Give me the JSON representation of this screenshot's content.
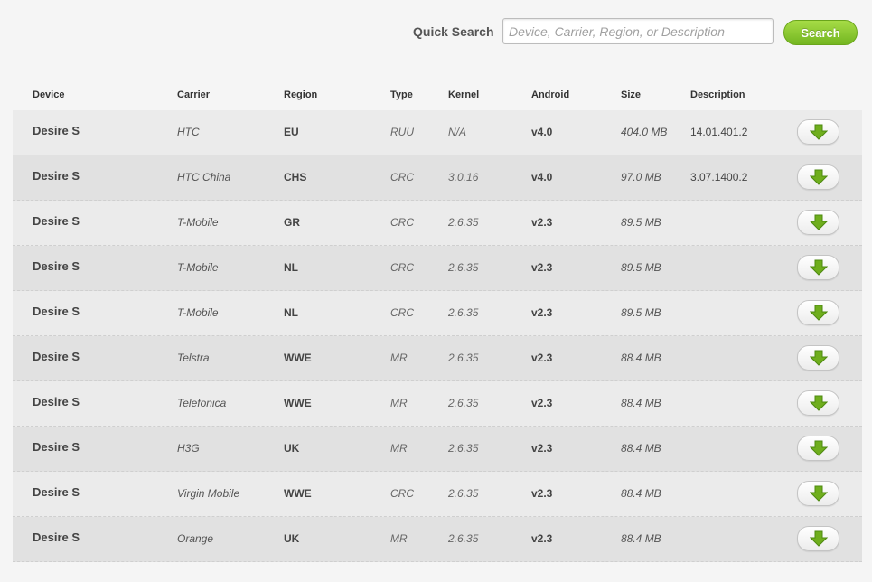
{
  "search": {
    "label": "Quick Search",
    "placeholder": "Device, Carrier, Region, or Description",
    "value": "",
    "button_label": "Search"
  },
  "table": {
    "headers": {
      "device": "Device",
      "carrier": "Carrier",
      "region": "Region",
      "type": "Type",
      "kernel": "Kernel",
      "android": "Android",
      "size": "Size",
      "description": "Description"
    },
    "rows": [
      {
        "device": "Desire S",
        "carrier": "HTC",
        "region": "EU",
        "type": "RUU",
        "kernel": "N/A",
        "android": "v4.0",
        "size": "404.0 MB",
        "description": "14.01.401.2",
        "action_icon": "download-arrow-icon"
      },
      {
        "device": "Desire S",
        "carrier": "HTC China",
        "region": "CHS",
        "type": "CRC",
        "kernel": "3.0.16",
        "android": "v4.0",
        "size": "97.0 MB",
        "description": "3.07.1400.2",
        "action_icon": "download-arrow-icon"
      },
      {
        "device": "Desire S",
        "carrier": "T-Mobile",
        "region": "GR",
        "type": "CRC",
        "kernel": "2.6.35",
        "android": "v2.3",
        "size": "89.5 MB",
        "description": "",
        "action_icon": "download-arrow-icon"
      },
      {
        "device": "Desire S",
        "carrier": "T-Mobile",
        "region": "NL",
        "type": "CRC",
        "kernel": "2.6.35",
        "android": "v2.3",
        "size": "89.5 MB",
        "description": "",
        "action_icon": "download-arrow-icon"
      },
      {
        "device": "Desire S",
        "carrier": "T-Mobile",
        "region": "NL",
        "type": "CRC",
        "kernel": "2.6.35",
        "android": "v2.3",
        "size": "89.5 MB",
        "description": "",
        "action_icon": "download-arrow-icon"
      },
      {
        "device": "Desire S",
        "carrier": "Telstra",
        "region": "WWE",
        "type": "MR",
        "kernel": "2.6.35",
        "android": "v2.3",
        "size": "88.4 MB",
        "description": "",
        "action_icon": "download-arrow-icon"
      },
      {
        "device": "Desire S",
        "carrier": "Telefonica",
        "region": "WWE",
        "type": "MR",
        "kernel": "2.6.35",
        "android": "v2.3",
        "size": "88.4 MB",
        "description": "",
        "action_icon": "download-arrow-icon"
      },
      {
        "device": "Desire S",
        "carrier": "H3G",
        "region": "UK",
        "type": "MR",
        "kernel": "2.6.35",
        "android": "v2.3",
        "size": "88.4 MB",
        "description": "",
        "action_icon": "download-arrow-icon"
      },
      {
        "device": "Desire S",
        "carrier": "Virgin Mobile",
        "region": "WWE",
        "type": "CRC",
        "kernel": "2.6.35",
        "android": "v2.3",
        "size": "88.4 MB",
        "description": "",
        "action_icon": "download-arrow-icon"
      },
      {
        "device": "Desire S",
        "carrier": "Orange",
        "region": "UK",
        "type": "MR",
        "kernel": "2.6.35",
        "android": "v2.3",
        "size": "88.4 MB",
        "description": "",
        "action_icon": "download-arrow-icon"
      }
    ]
  },
  "colors": {
    "accent_green": "#74b621",
    "page_background": "#f5f5f5",
    "row_light": "#ebebeb",
    "row_dark": "#e1e1e1"
  }
}
